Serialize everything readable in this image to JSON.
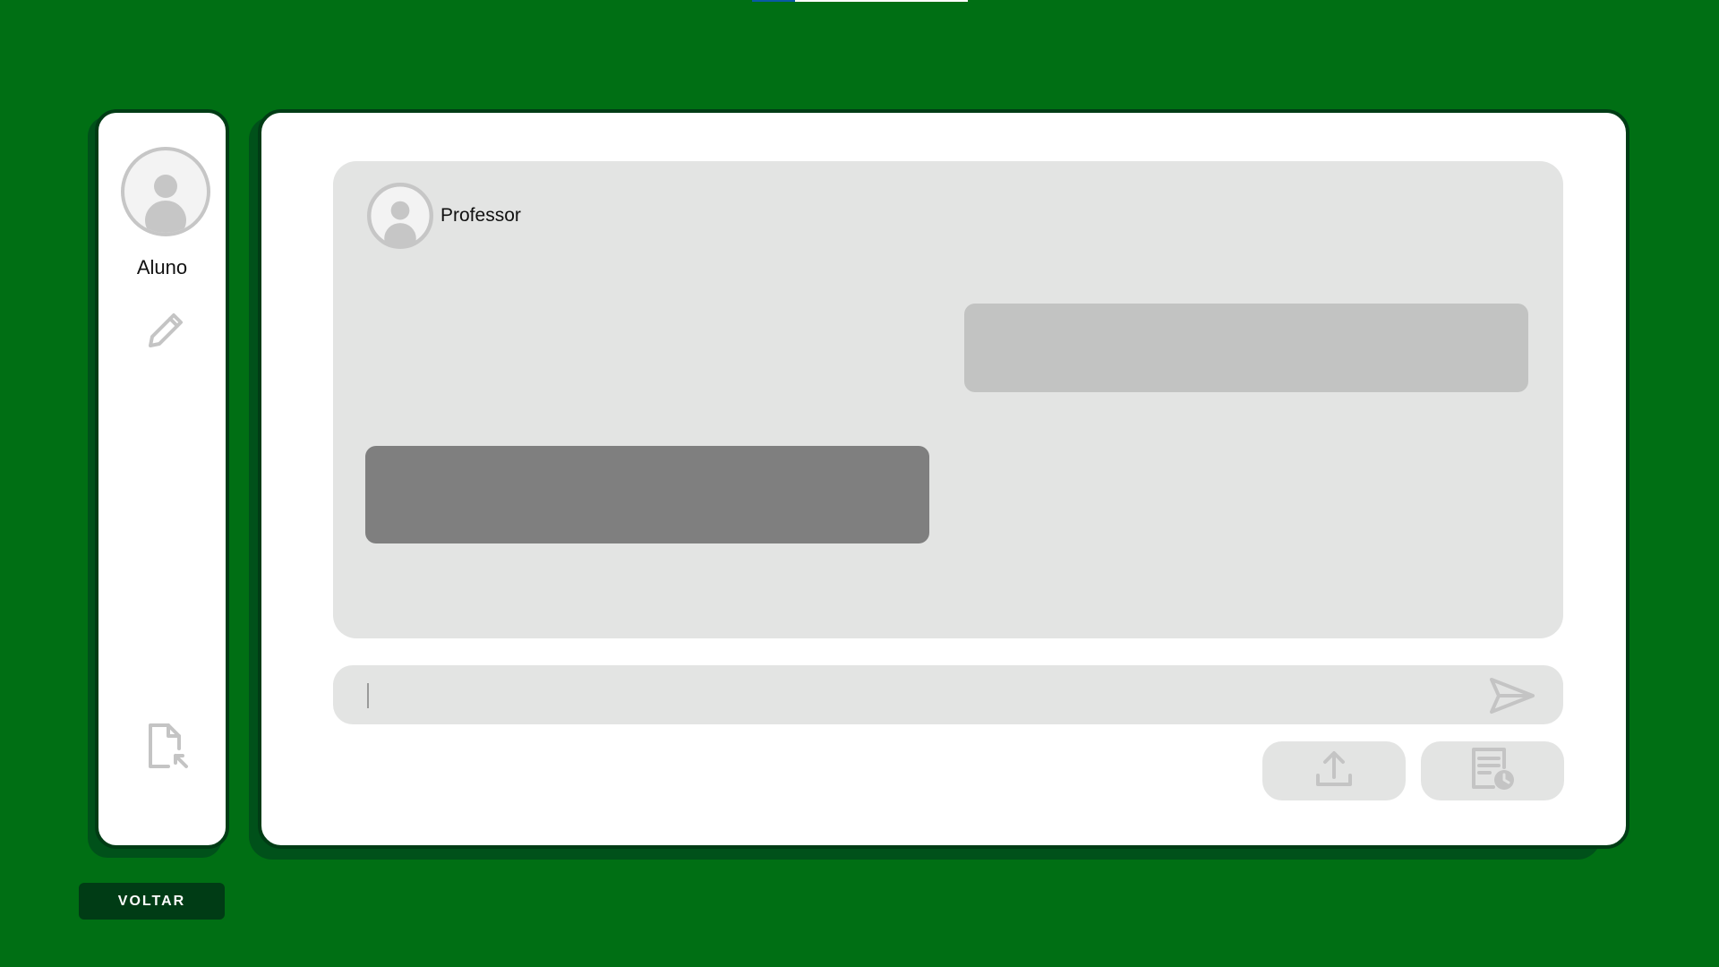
{
  "top_indicator": {
    "progress_fraction": 0.2
  },
  "sidebar": {
    "user_name": "Aluno",
    "avatar_icon": "user-avatar-icon",
    "edit_icon": "pencil-icon",
    "file_icon": "file-export-icon"
  },
  "chat": {
    "contact_name": "Professor",
    "contact_avatar_icon": "user-avatar-icon",
    "messages": [
      {
        "side": "right",
        "text": ""
      },
      {
        "side": "left",
        "text": ""
      }
    ]
  },
  "composer": {
    "value": "",
    "placeholder": "",
    "send_icon": "send-icon"
  },
  "actions": {
    "upload_icon": "upload-icon",
    "history_icon": "document-clock-icon"
  },
  "footer": {
    "back_label": "VOLTAR"
  },
  "colors": {
    "background": "#006f14",
    "panel_border": "#003c15",
    "panel_surface": "#e3e4e3",
    "bubble_incoming": "#c2c3c2",
    "bubble_outgoing": "#7f7f7f",
    "icon_gray": "#c4c4c4"
  }
}
